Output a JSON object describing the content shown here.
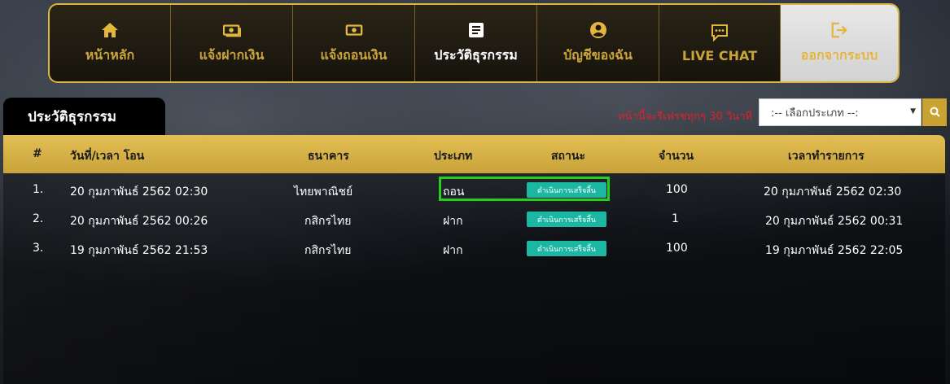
{
  "nav": {
    "items": [
      {
        "label": "หน้าหลัก",
        "icon": "home-icon"
      },
      {
        "label": "แจ้งฝากเงิน",
        "icon": "money-icon"
      },
      {
        "label": "แจ้งถอนเงิน",
        "icon": "money-icon"
      },
      {
        "label": "ประวัติธุรกรรม",
        "icon": "document-icon"
      },
      {
        "label": "บัญชีของฉัน",
        "icon": "user-icon"
      },
      {
        "label": "LIVE CHAT",
        "icon": "chat-icon"
      },
      {
        "label": "ออกจากระบบ",
        "icon": "logout-icon"
      }
    ]
  },
  "section": {
    "title": "ประวัติธุรกรรม",
    "refresh_note": "หน้านี้จะรีเฟรชทุกๆ 30 วินาที"
  },
  "filter": {
    "select_value": ":-- เลือกประเภท --:",
    "search_icon": "search-icon"
  },
  "table": {
    "headers": [
      "#",
      "วันที่/เวลา โอน",
      "ธนาคาร",
      "ประเภท",
      "สถานะ",
      "จำนวน",
      "เวลาทำรายการ"
    ],
    "rows": [
      {
        "num": "1.",
        "datetime": "20 กุมภาพันธ์ 2562 02:30",
        "bank": "ไทยพาณิชย์",
        "type": "ถอน",
        "status": "ดำเนินการเสร็จสิ้น",
        "amount": "100",
        "processed": "20 กุมภาพันธ์ 2562 02:30"
      },
      {
        "num": "2.",
        "datetime": "20 กุมภาพันธ์ 2562 00:26",
        "bank": "กสิกรไทย",
        "type": "ฝาก",
        "status": "ดำเนินการเสร็จสิ้น",
        "amount": "1",
        "processed": "20 กุมภาพันธ์ 2562 00:31"
      },
      {
        "num": "3.",
        "datetime": "19 กุมภาพันธ์ 2562 21:53",
        "bank": "กสิกรไทย",
        "type": "ฝาก",
        "status": "ดำเนินการเสร็จสิ้น",
        "amount": "100",
        "processed": "19 กุมภาพันธ์ 2562 22:05"
      }
    ]
  },
  "colors": {
    "gold": "#e0b53c",
    "status_badge": "#1bb7a3",
    "refresh_note": "#e0202a",
    "highlight": "#22d11d"
  }
}
